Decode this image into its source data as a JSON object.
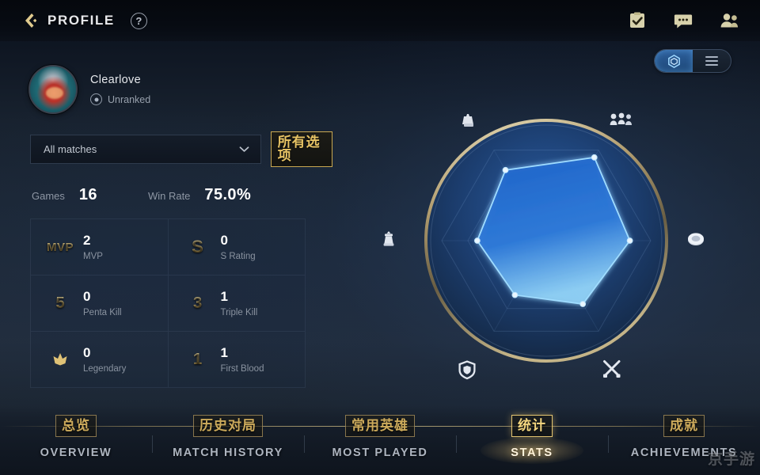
{
  "header": {
    "back_icon": "back-chevron-icon",
    "title": "PROFILE",
    "help_label": "?",
    "icons": [
      {
        "name": "tasks-icon",
        "label": "Tasks"
      },
      {
        "name": "chat-icon",
        "label": "Chat"
      },
      {
        "name": "friends-icon",
        "label": "Friends"
      }
    ]
  },
  "view_toggle": {
    "segments": [
      {
        "name": "radar-view-segment",
        "icon": "hexagon-radar-icon",
        "active": true
      },
      {
        "name": "list-view-segment",
        "icon": "list-lines-icon",
        "active": false
      }
    ]
  },
  "player": {
    "avatar": "player-avatar",
    "name": "Clearlove",
    "rank_icon": "rank-emblem-icon",
    "rank": "Unranked"
  },
  "filter": {
    "selected": "All matches",
    "placeholder": "All matches",
    "chevron_icon": "chevron-down-icon",
    "annotation_cn": "所有选项"
  },
  "summary": {
    "games_label": "Games",
    "games_value": "16",
    "winrate_label": "Win Rate",
    "winrate_value": "75.0%"
  },
  "stats": [
    {
      "icon": "mvp-icon",
      "icon_glyph": "MVP",
      "value": "2",
      "label": "MVP"
    },
    {
      "icon": "s-rating-icon",
      "icon_glyph": "S",
      "value": "0",
      "label": "S Rating"
    },
    {
      "icon": "penta-kill-icon",
      "icon_glyph": "5",
      "value": "0",
      "label": "Penta Kill"
    },
    {
      "icon": "triple-kill-icon",
      "icon_glyph": "3",
      "value": "1",
      "label": "Triple Kill"
    },
    {
      "icon": "legendary-icon",
      "icon_glyph": "✦",
      "value": "0",
      "label": "Legendary"
    },
    {
      "icon": "first-blood-icon",
      "icon_glyph": "1",
      "value": "1",
      "label": "First Blood"
    }
  ],
  "chart_data": {
    "type": "radar",
    "title": "",
    "axes": [
      {
        "name": "towers-icon",
        "angle_deg": -120,
        "icon": "tower-destroy-icon",
        "value": 0.78
      },
      {
        "name": "minions-icon",
        "angle_deg": -60,
        "icon": "minions-icon",
        "value": 0.92
      },
      {
        "name": "objectives-icon",
        "angle_deg": 180,
        "icon": "turret-chess-icon",
        "value": 0.66
      },
      {
        "name": "gold-icon",
        "angle_deg": 0,
        "icon": "gold-coin-icon",
        "value": 0.8
      },
      {
        "name": "survival-icon",
        "angle_deg": 120,
        "icon": "shield-icon",
        "value": 0.6
      },
      {
        "name": "combat-icon",
        "angle_deg": 60,
        "icon": "crossed-swords-icon",
        "value": 0.7
      }
    ],
    "max": 1.0,
    "rings": 4,
    "fill_color": "#1d63c8",
    "line_color": "#8fd0ff",
    "frame_color": "#c7b078"
  },
  "nav_tabs": [
    {
      "cn": "总览",
      "en": "OVERVIEW",
      "active": false
    },
    {
      "cn": "历史对局",
      "en": "MATCH HISTORY",
      "active": false
    },
    {
      "cn": "常用英雄",
      "en": "MOST PLAYED",
      "active": false
    },
    {
      "cn": "统计",
      "en": "STATS",
      "active": true
    },
    {
      "cn": "成就",
      "en": "ACHIEVEMENTS",
      "active": false
    }
  ],
  "watermark": "京手游",
  "colors": {
    "gold": "#cdab5c",
    "accent_blue": "#2d5f9c",
    "text_primary": "#e6e8ec",
    "text_muted": "#8a93a0",
    "bg": "#1d2836"
  }
}
